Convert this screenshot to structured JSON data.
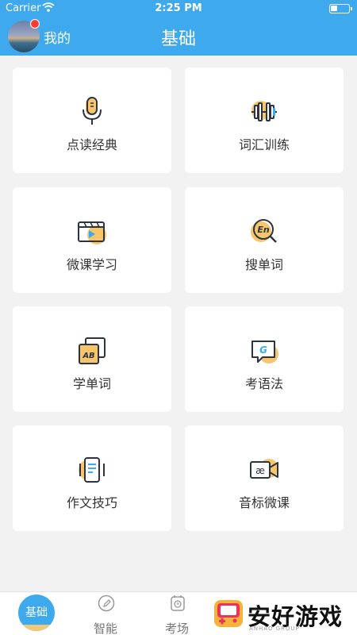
{
  "status_bar": {
    "carrier": "Carrier",
    "time": "2:25 PM"
  },
  "header": {
    "my_label": "我的",
    "title": "基础"
  },
  "cards": [
    {
      "label": "点读经典",
      "icon": "microphone-icon"
    },
    {
      "label": "词汇训练",
      "icon": "dumbbell-icon"
    },
    {
      "label": "微课学习",
      "icon": "video-play-icon"
    },
    {
      "label": "搜单词",
      "icon": "search-en-icon"
    },
    {
      "label": "学单词",
      "icon": "ab-cards-icon"
    },
    {
      "label": "考语法",
      "icon": "grammar-chat-icon"
    },
    {
      "label": "作文技巧",
      "icon": "document-phone-icon"
    },
    {
      "label": "音标微课",
      "icon": "phonetic-camera-icon"
    }
  ],
  "tabs": [
    {
      "label": "基础",
      "icon": "home-circle-icon",
      "active": true
    },
    {
      "label": "智能",
      "icon": "pencil-circle-icon",
      "active": false
    },
    {
      "label": "考场",
      "icon": "clock-icon",
      "active": false
    }
  ],
  "watermark": {
    "text": "安好游戏",
    "sub": "ANHAO GROUP"
  },
  "colors": {
    "primary": "#3fa9ee",
    "accent": "#f7c66b",
    "icon_stroke": "#2b3440"
  }
}
